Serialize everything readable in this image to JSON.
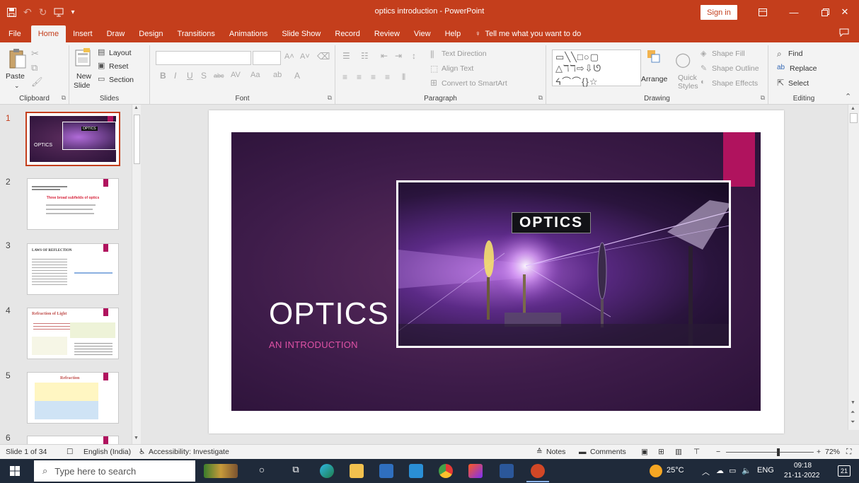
{
  "titlebar": {
    "title": "optics introduction - PowerPoint",
    "sign_in": "Sign in"
  },
  "tabs": [
    "File",
    "Home",
    "Insert",
    "Draw",
    "Design",
    "Transitions",
    "Animations",
    "Slide Show",
    "Record",
    "Review",
    "View",
    "Help"
  ],
  "tell_me": "Tell me what you want to do",
  "ribbon": {
    "clipboard": {
      "label": "Clipboard",
      "paste": "Paste"
    },
    "slides": {
      "label": "Slides",
      "new_slide": "New",
      "new_slide_2": "Slide",
      "layout": "Layout",
      "reset": "Reset",
      "section": "Section"
    },
    "font": {
      "label": "Font"
    },
    "paragraph": {
      "label": "Paragraph",
      "text_direction": "Text Direction",
      "align_text": "Align Text",
      "convert_smartart": "Convert to SmartArt"
    },
    "drawing": {
      "label": "Drawing",
      "arrange": "Arrange",
      "quick_styles": "Quick",
      "quick_styles_2": "Styles",
      "shape_fill": "Shape Fill",
      "shape_outline": "Shape Outline",
      "shape_effects": "Shape Effects"
    },
    "editing": {
      "label": "Editing",
      "find": "Find",
      "replace": "Replace",
      "select": "Select"
    }
  },
  "thumbnails": [
    {
      "num": "1",
      "title": "OPTICS",
      "photo_label": "OPTICS"
    },
    {
      "num": "2",
      "title": "Three broad subfields of optics"
    },
    {
      "num": "3",
      "title": "LAWS OF REFLECTION"
    },
    {
      "num": "4",
      "title": "Refraction of Light"
    },
    {
      "num": "5",
      "title": "Refraction"
    },
    {
      "num": "6"
    }
  ],
  "slide": {
    "title": "OPTICS",
    "subtitle": "AN INTRODUCTION",
    "photo_label": "OPTICS",
    "accent_color": "#b0135e"
  },
  "status": {
    "slide_count": "Slide 1 of 34",
    "language": "English (India)",
    "accessibility": "Accessibility: Investigate",
    "notes": "Notes",
    "comments": "Comments",
    "zoom": "72%"
  },
  "taskbar": {
    "search_placeholder": "Type here to search",
    "temperature": "25°C",
    "language": "ENG",
    "time": "09:18",
    "date": "21-11-2022",
    "notifications": "21"
  }
}
